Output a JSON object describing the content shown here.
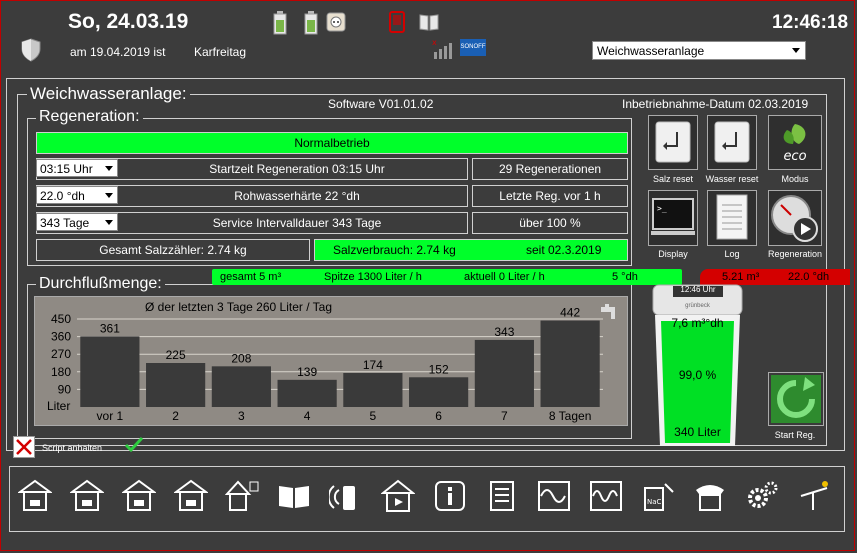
{
  "header": {
    "date": "So, 24.03.19",
    "time": "12:46:18",
    "subdate": "am 19.04.2019 ist",
    "holiday": "Karfreitag",
    "device_label": "SONOFF",
    "selected_view": "Weichwasseranlage"
  },
  "main": {
    "title": "Weichwasseranlage:",
    "software": "Software V01.01.02",
    "commission_date": "Inbetriebnahme-Datum 02.03.2019"
  },
  "regeneration": {
    "legend": "Regeneration:",
    "status": "Normalbetrieb",
    "rows": [
      {
        "select": "03:15 Uhr",
        "label": "Startzeit Regeneration 03:15 Uhr",
        "right": "29 Regenerationen"
      },
      {
        "select": "22.0 °dh",
        "label": "Rohwasserhärte 22 °dh",
        "right": "Letzte Reg. vor 1 h"
      },
      {
        "select": "343 Tage",
        "label": "Service Intervalldauer 343 Tage",
        "right": "über 100 %"
      }
    ],
    "salt_total": "Gesamt Salzzähler: 2.74 kg",
    "salt_usage": "Salzverbrauch: 2.74 kg",
    "salt_since": "seit 02.3.2019"
  },
  "buttons": {
    "salt_reset": "Salz reset",
    "water_reset": "Wasser reset",
    "mode": "Modus",
    "display": "Display",
    "log": "Log",
    "regeneration": "Regeneration",
    "start_reg": "Start Reg.",
    "eco": "eco"
  },
  "flow": {
    "legend": "Durchflußmenge:",
    "total": "gesamt 5 m³",
    "peak": "Spitze 1300 Liter / h",
    "current": "aktuell 0 Liter / h",
    "hardness_out": "5 °dh",
    "raw_volume": "5.21 m³",
    "raw_hardness": "22.0 °dh"
  },
  "tank": {
    "clock": "12:46 Uhr",
    "brand": "grünbeck",
    "value1": "7,6 m³°dh",
    "percent": "99,0 %",
    "liters": "340 Liter",
    "fill": 0.99
  },
  "script": {
    "label": "Script anhalten"
  },
  "chart_data": {
    "type": "bar",
    "title": "Ø der letzten 3 Tage 260 Liter / Tag",
    "ylabel": "Liter",
    "yticks": [
      "450",
      "360",
      "270",
      "180",
      "90"
    ],
    "ylim": [
      0,
      450
    ],
    "categories": [
      "vor 1",
      "2",
      "3",
      "4",
      "5",
      "6",
      "7",
      "8 Tagen"
    ],
    "values": [
      361,
      225,
      208,
      139,
      174,
      152,
      343,
      442
    ]
  },
  "colors": {
    "background": "#3c3c3c",
    "accent_green": "#00ff2a",
    "alert_red": "#d40000",
    "chart_bg": "#8f8a84",
    "bar": "#3a3a3a"
  }
}
